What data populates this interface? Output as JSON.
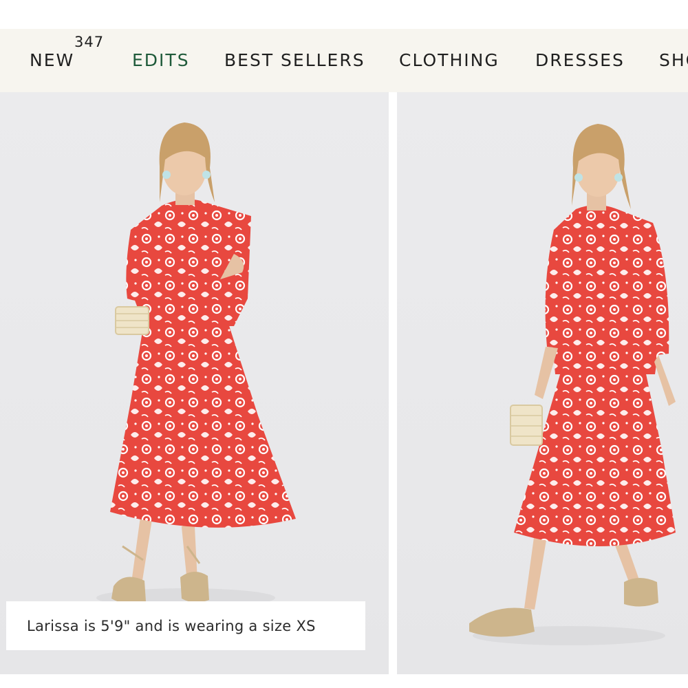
{
  "nav": {
    "badge_count": "347",
    "items": [
      {
        "label": "NEW"
      },
      {
        "label": "EDITS"
      },
      {
        "label": "BEST SELLERS"
      },
      {
        "label": "CLOTHING"
      },
      {
        "label": "DRESSES"
      },
      {
        "label": "SHO"
      }
    ],
    "active_color": "#1f5a3a"
  },
  "gallery": {
    "caption": "Larissa is 5'9\" and is wearing a size XS",
    "images": [
      {
        "icon": "model-front-pose-image"
      },
      {
        "icon": "model-walking-pose-image"
      }
    ],
    "colors": {
      "dress": "#e8483f",
      "print": "#ffffff",
      "background": "#eaeaec"
    }
  }
}
